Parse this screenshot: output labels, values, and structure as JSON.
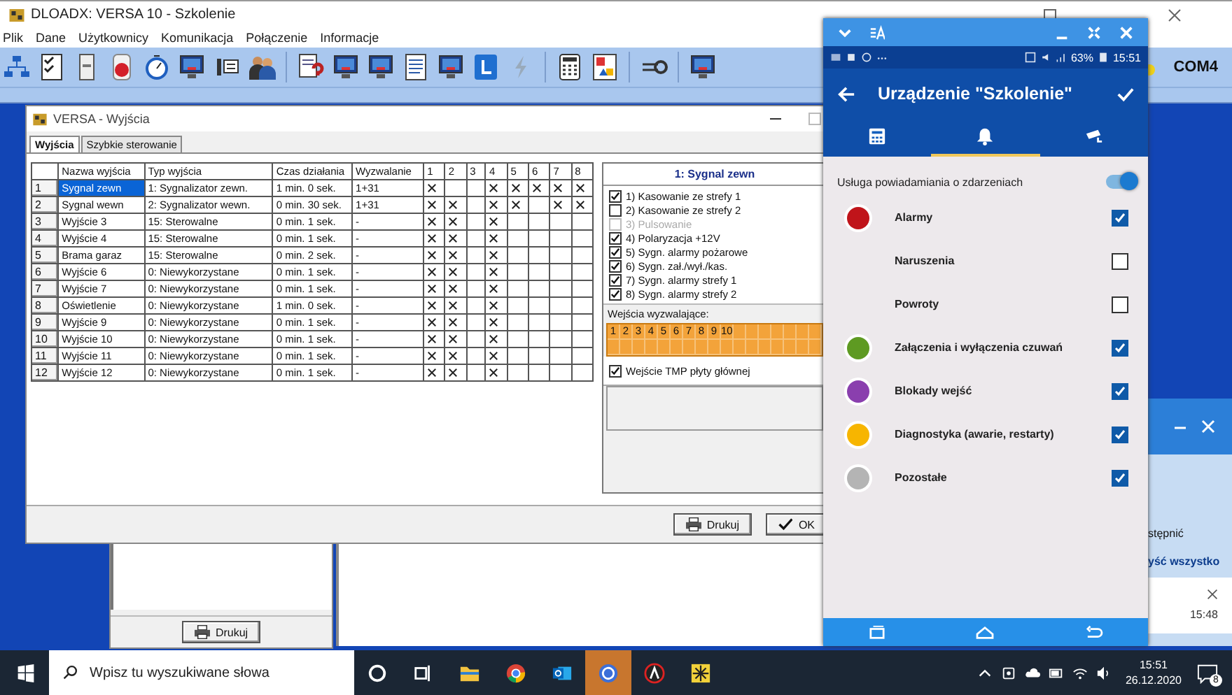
{
  "main_window": {
    "title": "DLOADX: VERSA 10 - Szkolenie",
    "menu": [
      "Plik",
      "Dane",
      "Użytkownicy",
      "Komunikacja",
      "Połączenie",
      "Informacje"
    ],
    "connection": {
      "port": "COM4",
      "connected": true
    }
  },
  "outputs_window": {
    "title": "VERSA - Wyjścia",
    "tabs": [
      {
        "label": "Wyjścia",
        "selected": true
      },
      {
        "label": "Szybkie sterowanie",
        "selected": false
      }
    ],
    "table": {
      "columns": [
        "Nazwa wyjścia",
        "Typ wyjścia",
        "Czas działania",
        "Wyzwalanie",
        "1",
        "2",
        "3",
        "4",
        "5",
        "6",
        "7",
        "8"
      ],
      "rows": [
        {
          "number": "1",
          "name": "Sygnal zewn",
          "type": "1: Sygnalizator zewn.",
          "time": "1 min. 0 sek.",
          "trigger": "1+31",
          "zones": [
            true,
            false,
            false,
            true,
            true,
            true,
            true,
            true
          ],
          "selected": true
        },
        {
          "number": "2",
          "name": "Sygnal wewn",
          "type": "2: Sygnalizator wewn.",
          "time": "0 min. 30 sek.",
          "trigger": "1+31",
          "zones": [
            true,
            true,
            false,
            true,
            true,
            false,
            true,
            true
          ],
          "selected": false
        },
        {
          "number": "3",
          "name": "Wyjście  3",
          "type": "15: Sterowalne",
          "time": "0 min. 1 sek.",
          "trigger": "-",
          "zones": [
            true,
            true,
            false,
            true,
            false,
            false,
            false,
            false
          ],
          "selected": false
        },
        {
          "number": "4",
          "name": "Wyjście  4",
          "type": "15: Sterowalne",
          "time": "0 min. 1 sek.",
          "trigger": "-",
          "zones": [
            true,
            true,
            false,
            true,
            false,
            false,
            false,
            false
          ],
          "selected": false
        },
        {
          "number": "5",
          "name": "Brama garaz",
          "type": "15: Sterowalne",
          "time": "0 min. 2 sek.",
          "trigger": "-",
          "zones": [
            true,
            true,
            false,
            true,
            false,
            false,
            false,
            false
          ],
          "selected": false
        },
        {
          "number": "6",
          "name": "Wyjście  6",
          "type": "0: Niewykorzystane",
          "time": "0 min. 1 sek.",
          "trigger": "-",
          "zones": [
            true,
            true,
            false,
            true,
            false,
            false,
            false,
            false
          ],
          "selected": false
        },
        {
          "number": "7",
          "name": "Wyjście  7",
          "type": "0: Niewykorzystane",
          "time": "0 min. 1 sek.",
          "trigger": "-",
          "zones": [
            true,
            true,
            false,
            true,
            false,
            false,
            false,
            false
          ],
          "selected": false
        },
        {
          "number": "8",
          "name": "Oświetlenie",
          "type": "0: Niewykorzystane",
          "time": "1 min. 0 sek.",
          "trigger": "-",
          "zones": [
            true,
            true,
            false,
            true,
            false,
            false,
            false,
            false
          ],
          "selected": false
        },
        {
          "number": "9",
          "name": "Wyjście  9",
          "type": "0: Niewykorzystane",
          "time": "0 min. 1 sek.",
          "trigger": "-",
          "zones": [
            true,
            true,
            false,
            true,
            false,
            false,
            false,
            false
          ],
          "selected": false
        },
        {
          "number": "10",
          "name": "Wyjście 10",
          "type": "0: Niewykorzystane",
          "time": "0 min. 1 sek.",
          "trigger": "-",
          "zones": [
            true,
            true,
            false,
            true,
            false,
            false,
            false,
            false
          ],
          "selected": false
        },
        {
          "number": "11",
          "name": "Wyjście 11",
          "type": "0: Niewykorzystane",
          "time": "0 min. 1 sek.",
          "trigger": "-",
          "zones": [
            true,
            true,
            false,
            true,
            false,
            false,
            false,
            false
          ],
          "selected": false
        },
        {
          "number": "12",
          "name": "Wyjście 12",
          "type": "0: Niewykorzystane",
          "time": "0 min. 1 sek.",
          "trigger": "-",
          "zones": [
            true,
            true,
            false,
            true,
            false,
            false,
            false,
            false
          ],
          "selected": false
        }
      ]
    },
    "details": {
      "title": "1: Sygnal zewn",
      "options": [
        {
          "label": "1) Kasowanie ze strefy 1",
          "checked": true,
          "disabled": false
        },
        {
          "label": "2) Kasowanie ze strefy 2",
          "checked": false,
          "disabled": false
        },
        {
          "label": "3) Pulsowanie",
          "checked": false,
          "disabled": true
        },
        {
          "label": "4) Polaryzacja +12V",
          "checked": true,
          "disabled": false
        },
        {
          "label": "5) Sygn. alarmy pożarowe",
          "checked": true,
          "disabled": false
        },
        {
          "label": "6) Sygn. zał./wył./kas.",
          "checked": true,
          "disabled": false
        },
        {
          "label": "7) Sygn. alarmy strefy 1",
          "checked": true,
          "disabled": false
        },
        {
          "label": "8) Sygn. alarmy strefy 2",
          "checked": true,
          "disabled": false
        }
      ],
      "inputs_label": "Wejścia wyzwalające:",
      "inputs": [
        "1",
        "2",
        "3",
        "4",
        "5",
        "6",
        "7",
        "8",
        "9",
        "10"
      ],
      "tamper": {
        "label": "Wejście TMP płyty głównej",
        "checked": true
      }
    },
    "buttons": [
      "Drukuj",
      "OK"
    ]
  },
  "background_panel": {
    "button": "Drukuj"
  },
  "notification": {
    "texts": [
      "stępnić",
      "yść wszystko"
    ],
    "time": "15:48"
  },
  "phone": {
    "status_bar": {
      "battery": "63%",
      "time": "15:51"
    },
    "title": "Urządzenie \"Szkolenie\"",
    "tabs": [
      {
        "selected": false
      },
      {
        "selected": true
      },
      {
        "selected": false
      }
    ],
    "service": {
      "label": "Usługa powiadamiania o zdarzeniach",
      "on": true
    },
    "events": [
      {
        "label": "Alarmy",
        "color": "#c0141a",
        "checked": true
      },
      {
        "label": "Naruszenia",
        "checked": false
      },
      {
        "label": "Powroty",
        "checked": false
      },
      {
        "label": "Załączenia i wyłączenia czuwań",
        "color": "#5e9a22",
        "checked": true
      },
      {
        "label": "Blokady wejść",
        "color": "#8a3fae",
        "checked": true
      },
      {
        "label": "Diagnostyka (awarie, restarty)",
        "color": "#f7b500",
        "checked": true
      },
      {
        "label": "Pozostałe",
        "color": "#b4b4b4",
        "checked": true
      }
    ]
  },
  "taskbar": {
    "search": {
      "placeholder": "Wpisz tu wyszukiwane słowa"
    },
    "apps": [
      {
        "active": false
      },
      {
        "active": false
      },
      {
        "active": false
      },
      {
        "active": false
      },
      {
        "active": false
      },
      {
        "active": true
      },
      {
        "active": false
      },
      {
        "active": false
      }
    ],
    "time": "15:51",
    "date": "26.12.2020",
    "notifications": "8"
  }
}
